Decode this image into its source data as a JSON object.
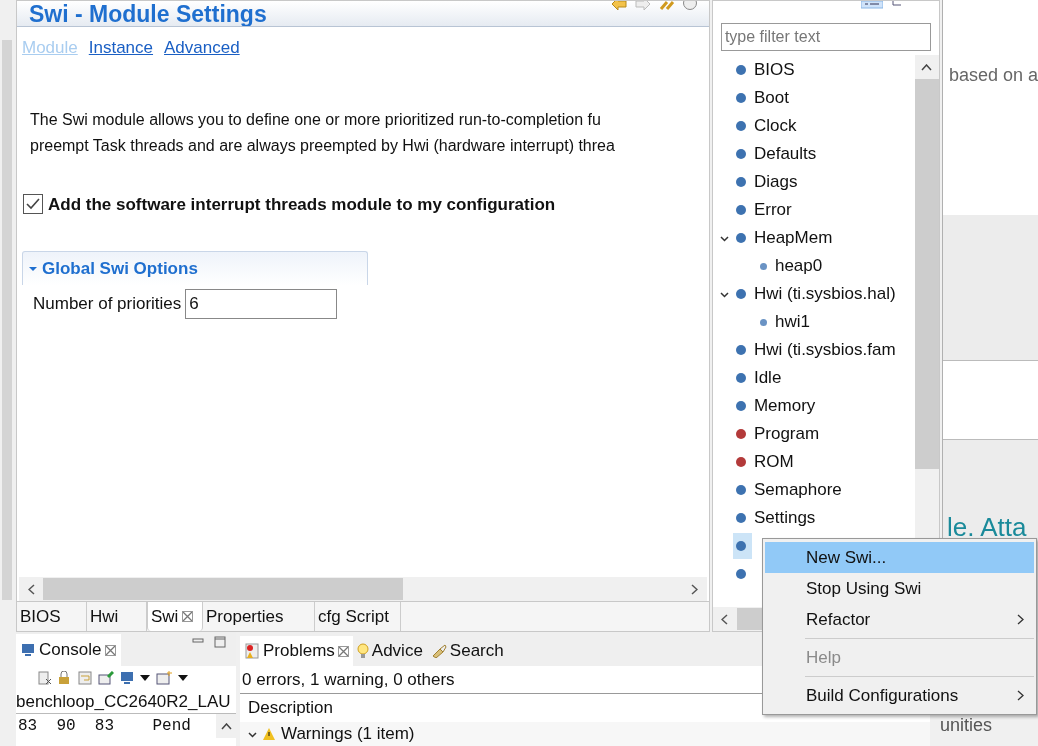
{
  "editor": {
    "title": "Swi - Module Settings",
    "links": [
      {
        "label": "Module",
        "selected": true
      },
      {
        "label": "Instance",
        "selected": false
      },
      {
        "label": "Advanced",
        "selected": false
      }
    ],
    "description": [
      "The Swi module allows you to define one or more prioritized run-to-completion fu",
      "preempt Task threads and are always preempted by Hwi (hardware interrupt) threa"
    ],
    "enable": {
      "label": "Add the software interrupt threads module to my configuration",
      "checked": true
    },
    "section": {
      "title": "Global Swi Options",
      "expanded": true,
      "fields": [
        {
          "label": "Number of priorities",
          "value": "6"
        }
      ]
    },
    "tabs": [
      {
        "label": "BIOS",
        "selected": false,
        "closable": false
      },
      {
        "label": "Hwi",
        "selected": false,
        "closable": false
      },
      {
        "label": "Swi",
        "selected": true,
        "closable": true
      },
      {
        "label": "Properties",
        "selected": false,
        "closable": false
      },
      {
        "label": "cfg Script",
        "selected": false,
        "closable": false
      }
    ]
  },
  "outline": {
    "placeholder": "type filter text",
    "items": [
      {
        "label": "BIOS",
        "color": "#3d72b0",
        "selected": false
      },
      {
        "label": "Boot",
        "color": "#3d72b0",
        "selected": false
      },
      {
        "label": "Clock",
        "color": "#3d72b0",
        "selected": false
      },
      {
        "label": "Defaults",
        "color": "#3d72b0",
        "selected": false
      },
      {
        "label": "Diags",
        "color": "#3d72b0",
        "selected": false
      },
      {
        "label": "Error",
        "color": "#3d72b0",
        "selected": false
      },
      {
        "label": "HeapMem",
        "color": "#3d72b0",
        "selected": false,
        "expanded": true,
        "children": [
          {
            "label": "heap0",
            "color": "#6a93c4",
            "selected": false
          }
        ]
      },
      {
        "label": "Hwi (ti.sysbios.hal)",
        "color": "#3d72b0",
        "selected": false,
        "expanded": true,
        "children": [
          {
            "label": "hwi1",
            "color": "#6a93c4",
            "selected": false
          }
        ]
      },
      {
        "label": "Hwi (ti.sysbios.fam",
        "color": "#3d72b0",
        "selected": false
      },
      {
        "label": "Idle",
        "color": "#3d72b0",
        "selected": false
      },
      {
        "label": "Memory",
        "color": "#3d72b0",
        "selected": false
      },
      {
        "label": "Program",
        "color": "#b33a3a",
        "selected": false
      },
      {
        "label": "ROM",
        "color": "#b33a3a",
        "selected": false
      },
      {
        "label": "Semaphore",
        "color": "#3d72b0",
        "selected": false
      },
      {
        "label": "Settings",
        "color": "#3d72b0",
        "selected": false
      },
      {
        "color": "#3d72b0",
        "selected": true
      },
      {
        "color": "#3d72b0",
        "selected": false
      }
    ]
  },
  "background_texts": [
    "based on a",
    "le. Atta",
    "unities"
  ],
  "console": {
    "title": "Console",
    "launch": "benchloop_CC2640R2_LAU",
    "lines": [
      "83  90  83    Pend"
    ]
  },
  "problems": {
    "tabs": [
      {
        "label": "Problems",
        "selected": true
      },
      {
        "label": "Advice",
        "selected": false
      },
      {
        "label": "Search",
        "selected": false
      }
    ],
    "summary": "0 errors, 1 warning, 0 others",
    "columns": [
      "Description"
    ],
    "groups": [
      {
        "label": "Warnings (1 item)",
        "expanded": true
      }
    ]
  },
  "context_menu": [
    {
      "kind": "item",
      "label": "New Swi...",
      "selected": true,
      "disabled": false,
      "submenu": false
    },
    {
      "kind": "item",
      "label": "Stop Using Swi",
      "selected": false,
      "disabled": false,
      "submenu": false
    },
    {
      "kind": "item",
      "label": "Refactor",
      "selected": false,
      "disabled": false,
      "submenu": true
    },
    {
      "kind": "separator"
    },
    {
      "kind": "item",
      "label": "Help",
      "selected": false,
      "disabled": true,
      "submenu": false
    },
    {
      "kind": "separator"
    },
    {
      "kind": "item",
      "label": "Build Configurations",
      "selected": false,
      "disabled": false,
      "submenu": true
    }
  ]
}
